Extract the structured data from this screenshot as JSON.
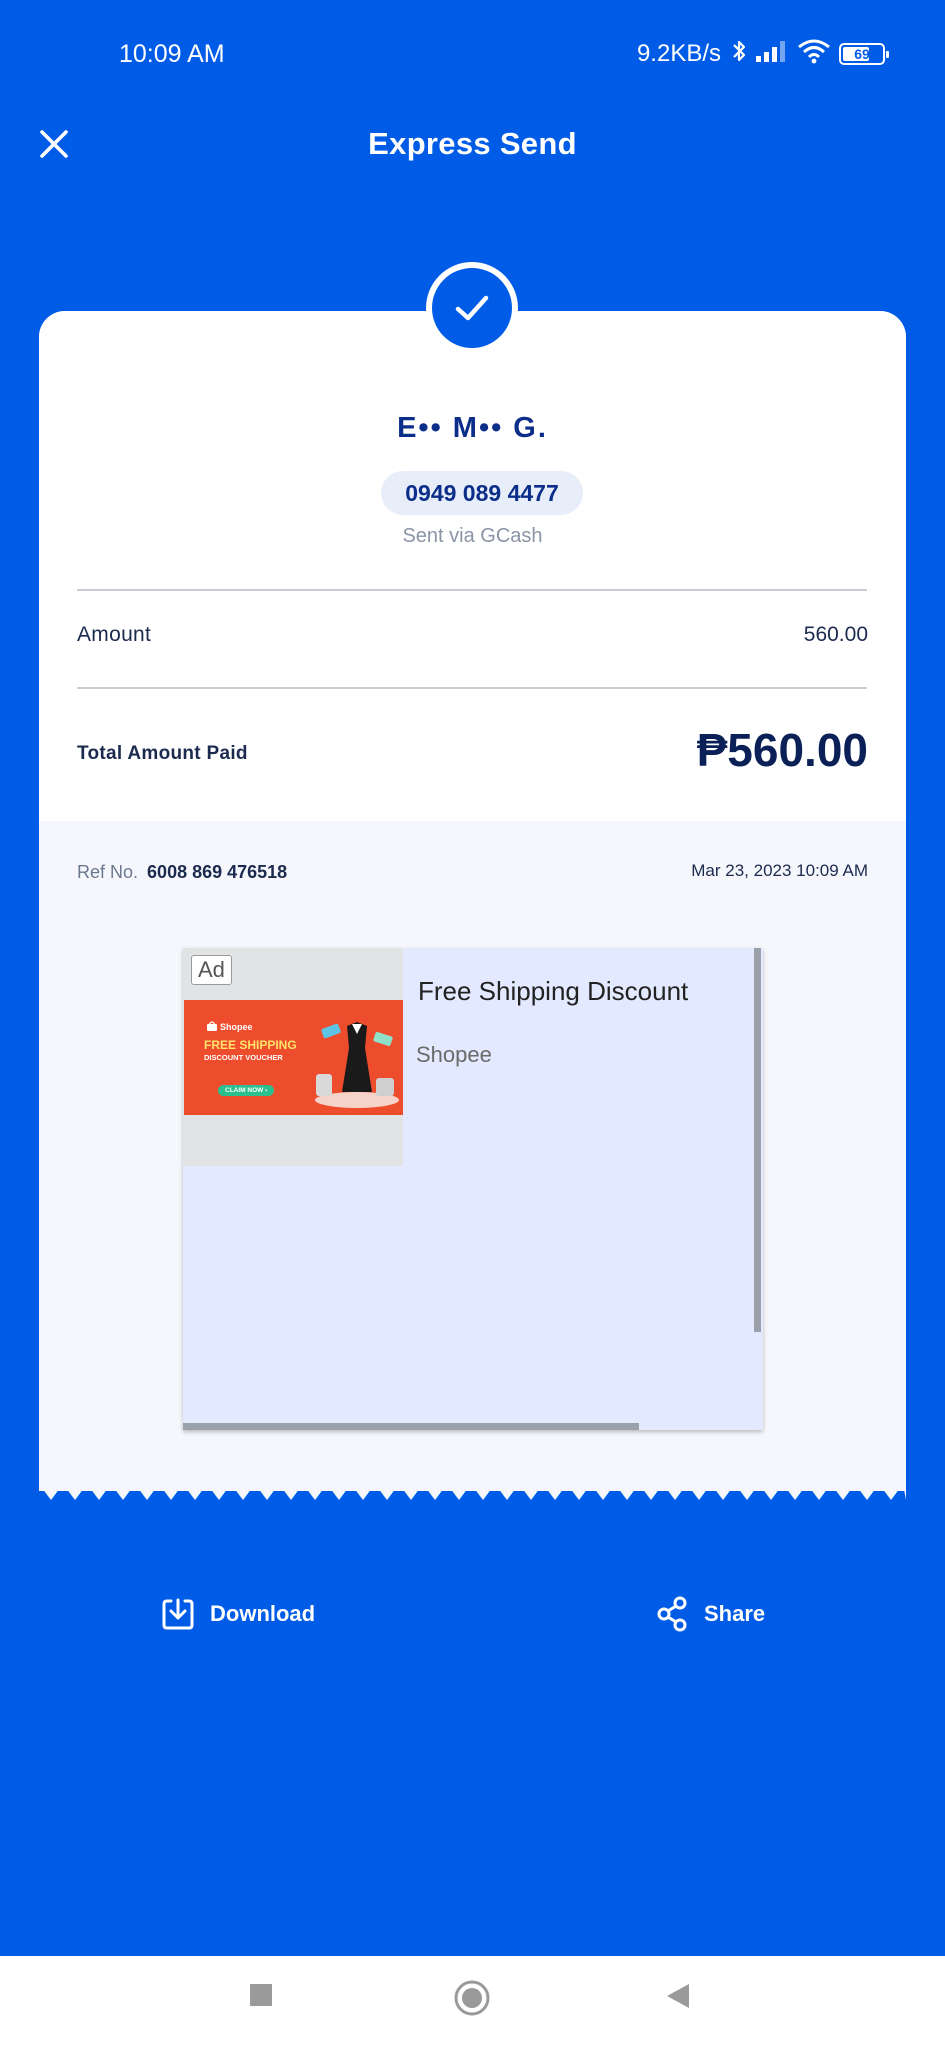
{
  "status_bar": {
    "time": "10:09 AM",
    "network_speed": "9.2KB/s",
    "battery_level": "69",
    "battery_fraction": 0.69,
    "icons": [
      "bluetooth-icon",
      "signal-icon",
      "wifi-icon",
      "battery-icon"
    ]
  },
  "header": {
    "title": "Express Send",
    "close_icon": "close-icon"
  },
  "receipt": {
    "recipient_name": "E•• M•• G.",
    "phone": "0949 089 4477",
    "sent_via": "Sent via GCash",
    "amount_label": "Amount",
    "amount_value": "560.00",
    "total_label": "Total Amount Paid",
    "total_value": "₱560.00",
    "ref_label": "Ref No.",
    "ref_number": "6008 869 476518",
    "date": "Mar 23, 2023 10:09 AM"
  },
  "ad": {
    "badge": "Ad",
    "title": "Free Shipping Discount",
    "advertiser": "Shopee",
    "banner": {
      "brand": "Shopee",
      "headline": "FREE SHIPPING",
      "subheadline": "DISCOUNT VOUCHER",
      "cta": "CLAIM NOW ›"
    }
  },
  "actions": {
    "download_label": "Download",
    "share_label": "Share"
  },
  "nav": {
    "buttons": [
      "recents-button",
      "home-button",
      "back-button"
    ]
  },
  "colors": {
    "brand_blue": "#005ce6",
    "text_navy": "#0b2e8a",
    "card_bg": "#ffffff",
    "ref_bg": "#f5f7fc",
    "ad_bg": "#e3eaff",
    "shopee_orange": "#ee4d2d"
  }
}
